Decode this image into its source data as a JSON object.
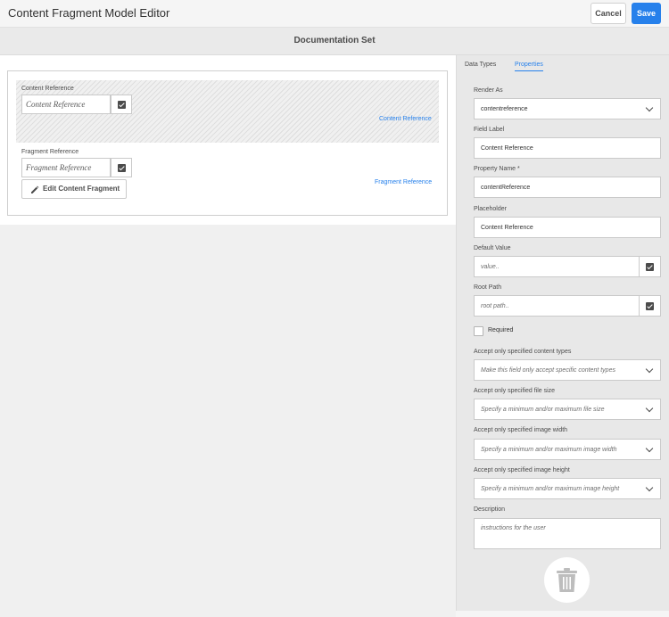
{
  "header": {
    "title": "Content Fragment Model Editor",
    "cancel_label": "Cancel",
    "save_label": "Save"
  },
  "model_title": "Documentation Set",
  "canvas": {
    "fields": [
      {
        "label": "Content Reference",
        "placeholder": "Content Reference",
        "type_link": "Content Reference",
        "checked": true
      },
      {
        "label": "Fragment Reference",
        "placeholder": "Fragment Reference",
        "type_link": "Fragment Reference",
        "checked": true,
        "action_label": "Edit Content Fragment"
      }
    ]
  },
  "panel": {
    "tabs": [
      {
        "label": "Data Types",
        "active": false
      },
      {
        "label": "Properties",
        "active": true
      }
    ],
    "render_as": {
      "label": "Render As",
      "value": "contentreference"
    },
    "field_label": {
      "label": "Field Label",
      "value": "Content Reference"
    },
    "property_name": {
      "label": "Property Name *",
      "value": "contentReference"
    },
    "placeholder": {
      "label": "Placeholder",
      "value": "Content Reference"
    },
    "default_value": {
      "label": "Default Value",
      "placeholder": "value.."
    },
    "root_path": {
      "label": "Root Path",
      "placeholder": "root path.."
    },
    "required": {
      "label": "Required",
      "checked": false
    },
    "content_types": {
      "label": "Accept only specified content types",
      "placeholder": "Make this field only accept specific content types"
    },
    "file_size": {
      "label": "Accept only specified file size",
      "placeholder": "Specify a minimum and/or maximum file size"
    },
    "image_width": {
      "label": "Accept only specified image width",
      "placeholder": "Specify a minimum and/or maximum image width"
    },
    "image_height": {
      "label": "Accept only specified image height",
      "placeholder": "Specify a minimum and/or maximum image height"
    },
    "description": {
      "label": "Description",
      "placeholder": "instructions for the user"
    }
  },
  "colors": {
    "accent": "#2680eb",
    "panel_bg": "#e8e8e8"
  }
}
